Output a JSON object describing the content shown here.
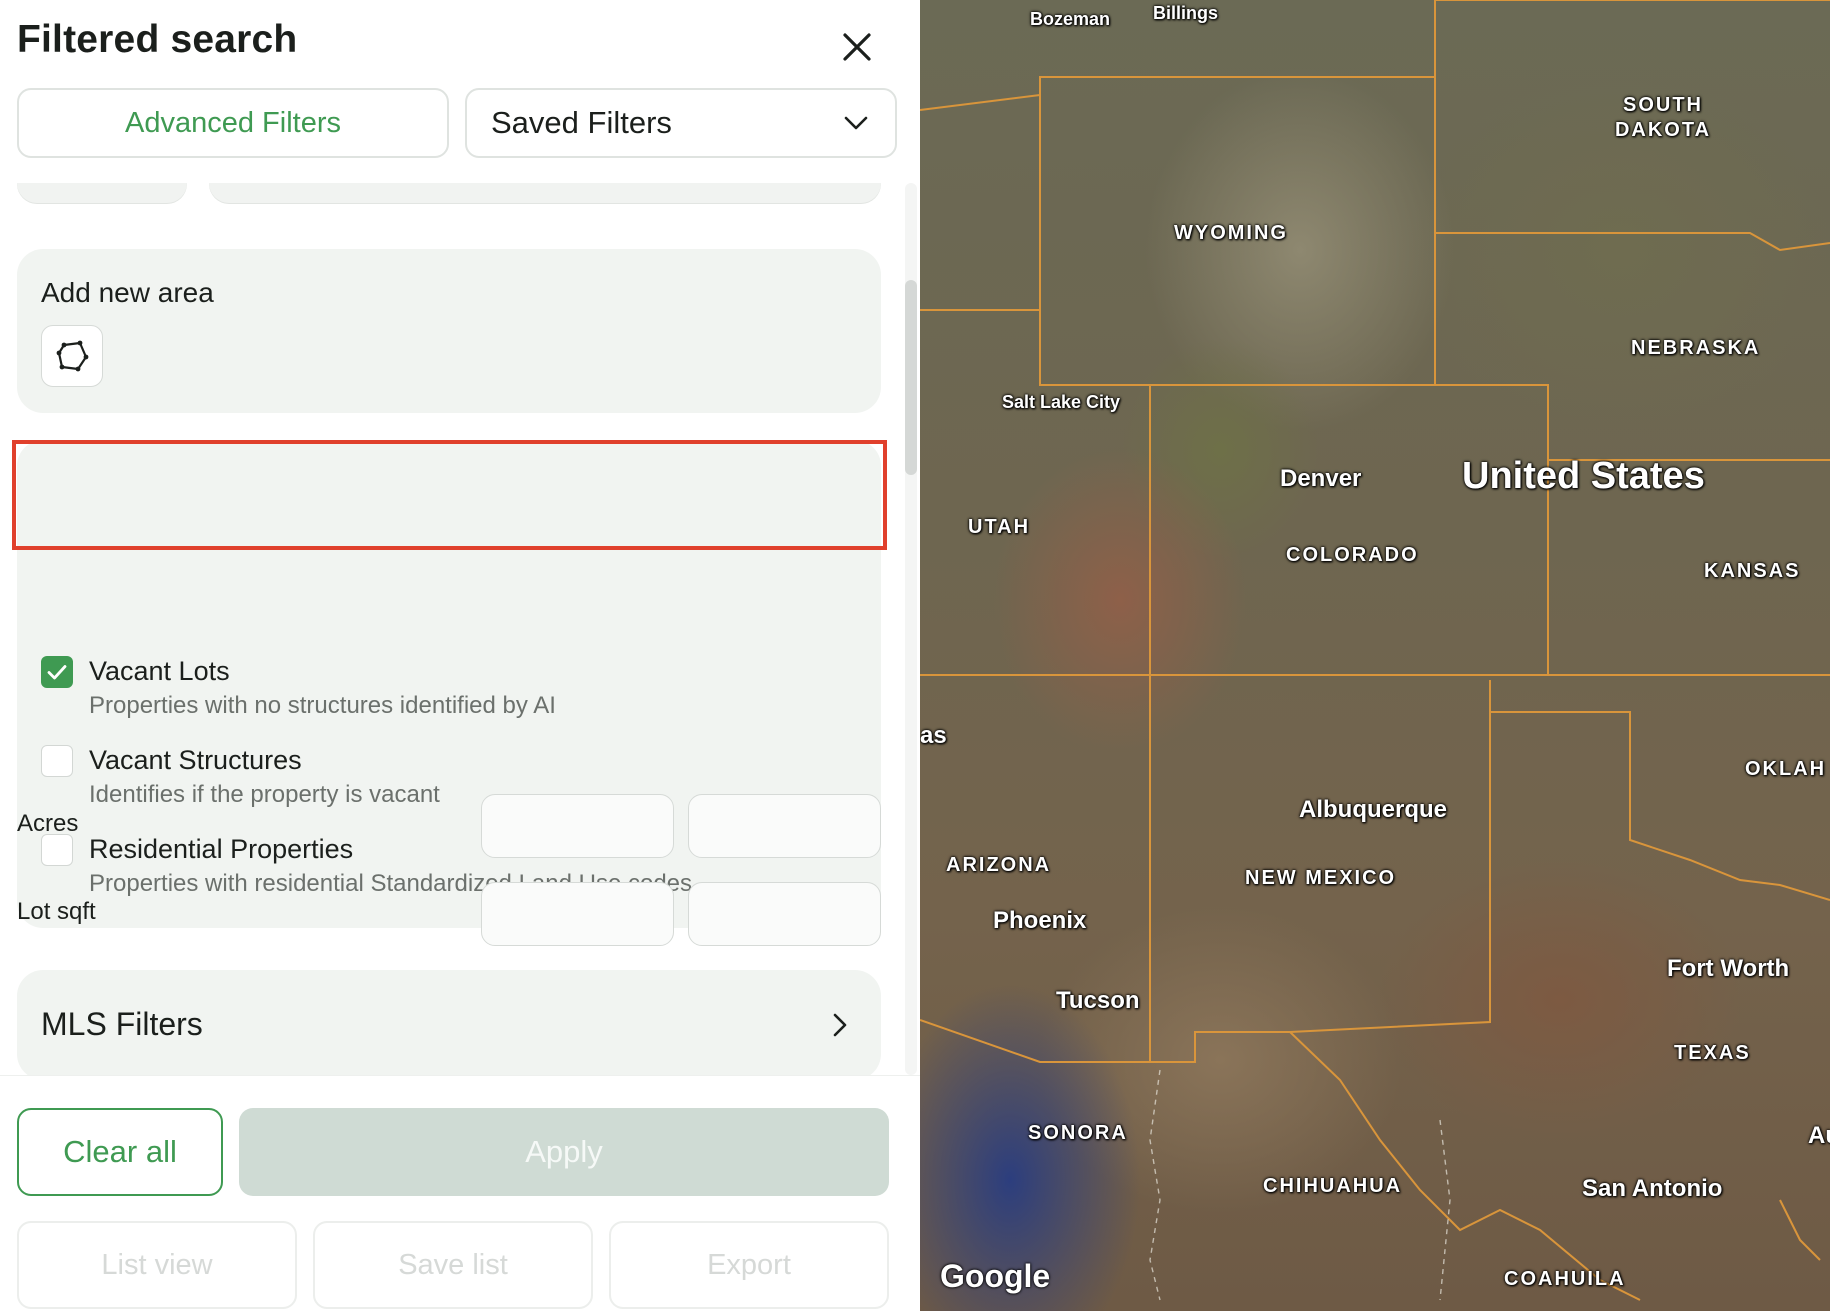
{
  "header": {
    "title": "Filtered search",
    "close_icon": "close-icon"
  },
  "tabs": {
    "advanced_label": "Advanced Filters",
    "saved_label": "Saved Filters"
  },
  "area": {
    "label": "Add new area",
    "icon": "polygon-draw-icon"
  },
  "checks": [
    {
      "title": "Vacant Lots",
      "desc": "Properties with no structures identified by AI",
      "checked": true
    },
    {
      "title": "Vacant Structures",
      "desc": "Identifies if the property is vacant",
      "checked": false
    },
    {
      "title": "Residential Properties",
      "desc": "Properties with residential Standardized Land Use codes",
      "checked": false
    }
  ],
  "ranges": {
    "acres_label": "Acres",
    "lot_label": "Lot sqft"
  },
  "mls": {
    "label": "MLS Filters"
  },
  "footer": {
    "clear_label": "Clear all",
    "apply_label": "Apply",
    "list_label": "List view",
    "save_label": "Save list",
    "export_label": "Export"
  },
  "colors": {
    "accent": "#3f9a52",
    "highlight": "#e0402c",
    "state_border": "#d9953b"
  },
  "map": {
    "states": [
      "SOUTH DAKOTA",
      "WYOMING",
      "NEBRASKA",
      "UTAH",
      "COLORADO",
      "KANSAS",
      "ARIZONA",
      "NEW MEXICO",
      "OKLAH",
      "TEXAS",
      "SONORA",
      "CHIHUAHUA",
      "COAHUILA"
    ],
    "country": "United States",
    "cities": [
      "Bozeman",
      "Billings",
      "Salt Lake City",
      "Denver",
      "Albuquerque",
      "Phoenix",
      "Tucson",
      "Fort Worth",
      "San Antonio",
      "as",
      "Au"
    ],
    "attribution": "Google"
  }
}
